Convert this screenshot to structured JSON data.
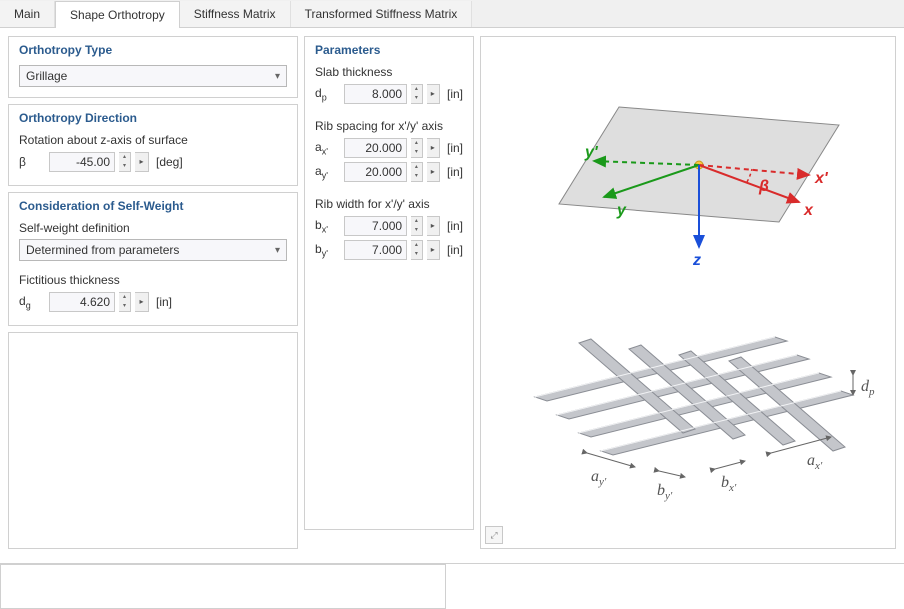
{
  "tabs": {
    "main": "Main",
    "shape": "Shape Orthotropy",
    "stiff": "Stiffness Matrix",
    "trans": "Transformed Stiffness Matrix"
  },
  "orthotropy_type": {
    "title": "Orthotropy Type",
    "value": "Grillage"
  },
  "direction": {
    "title": "Orthotropy Direction",
    "label": "Rotation about z-axis of surface",
    "symbol": "β",
    "value": "-45.00",
    "unit": "[deg]"
  },
  "self_weight": {
    "title": "Consideration of Self-Weight",
    "def_label": "Self-weight definition",
    "def_value": "Determined from parameters",
    "fict_label": "Fictitious thickness",
    "fict_symbol_html": "d<sub>g</sub>",
    "fict_value": "4.620",
    "fict_unit": "[in]"
  },
  "parameters": {
    "title": "Parameters",
    "slab_label": "Slab thickness",
    "dp_html": "d<sub>p</sub>",
    "dp_value": "8.000",
    "dp_unit": "[in]",
    "spacing_label": "Rib spacing for x'/y' axis",
    "ax_html": "a<sub>x'</sub>",
    "ax_value": "20.000",
    "ax_unit": "[in]",
    "ay_html": "a<sub>y'</sub>",
    "ay_value": "20.000",
    "ay_unit": "[in]",
    "width_label": "Rib width for x'/y' axis",
    "bx_html": "b<sub>x'</sub>",
    "bx_value": "7.000",
    "bx_unit": "[in]",
    "by_html": "b<sub>y'</sub>",
    "by_value": "7.000",
    "by_unit": "[in]"
  },
  "axes": {
    "x": "x",
    "xprime": "x'",
    "y": "y",
    "yprime": "y'",
    "z": "z",
    "beta": "β"
  },
  "dims": {
    "dp": "d",
    "dp_sub": "p",
    "ax": "a",
    "ax_sub": "x'",
    "ay": "a",
    "ay_sub": "y'",
    "bx": "b",
    "bx_sub": "x'",
    "by": "b",
    "by_sub": "y'"
  }
}
